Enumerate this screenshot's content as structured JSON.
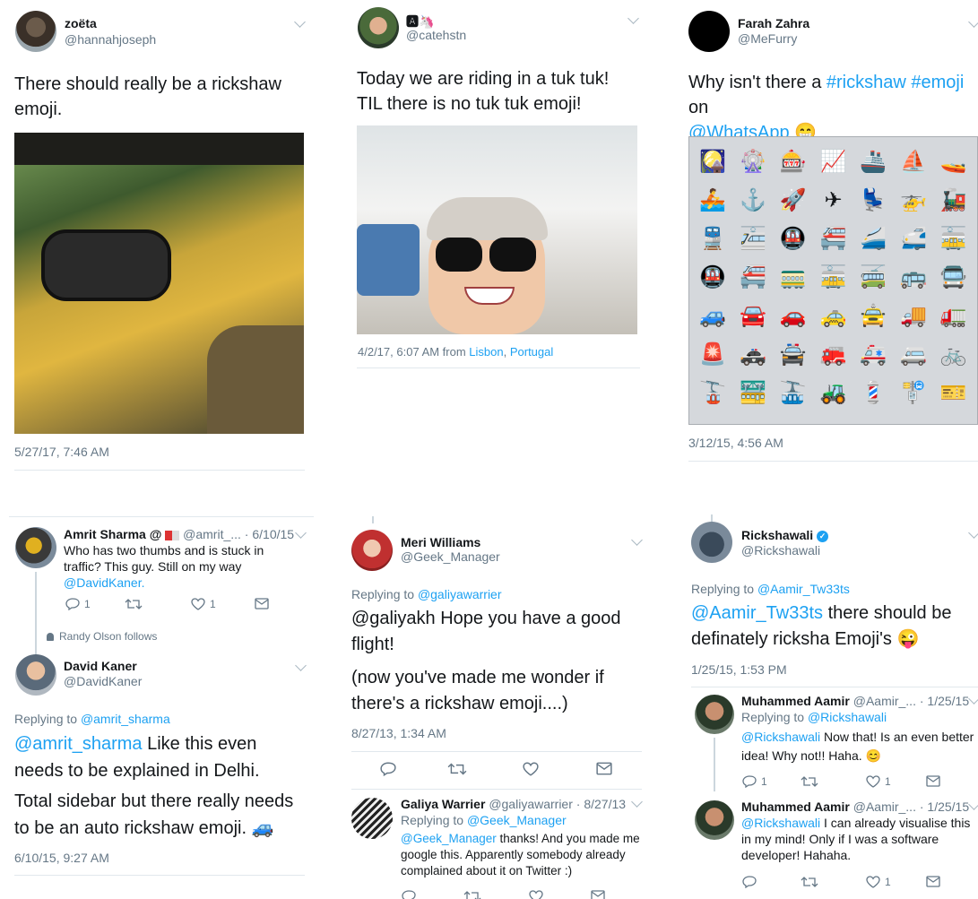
{
  "tweet1": {
    "name": "zoëta",
    "handle": "@hannahjoseph",
    "text": "There should really be a rickshaw emoji.",
    "timestamp": "5/27/17, 7:46 AM",
    "avatar_icon": "user-photo-icon"
  },
  "tweet2": {
    "name": "🅰🦄",
    "handle": "@catehstn",
    "text": "Today we are riding in a tuk tuk! TIL there is no tuk tuk emoji!",
    "time": "4/2/17, 6:07 AM from ",
    "place_city": "Lisbon",
    "place_sep": ", ",
    "place_country": "Portugal"
  },
  "tweet3": {
    "name": "Farah Zahra",
    "handle": "@MeFurry",
    "text_pre": "Why isn't there a ",
    "tag1": "#rickshaw",
    "tag2": "#emoji",
    "text_mid": " on",
    "mention": "@WhatsApp",
    "emoji": "😁",
    "timestamp": "3/12/15, 4:56 AM",
    "emoji_grid": [
      "🎑",
      "🎡",
      "🎰",
      "📈",
      "🚢",
      "⛵",
      "🚤",
      "🚣",
      "⚓",
      "🚀",
      "✈",
      "💺",
      "🚁",
      "🚂",
      "🚆",
      "🚈",
      "🚇",
      "🚝",
      "🚄",
      "🚅",
      "🚋",
      "🚇",
      "🚝",
      "🚃",
      "🚋",
      "🚎",
      "🚌",
      "🚍",
      "🚙",
      "🚘",
      "🚗",
      "🚕",
      "🚖",
      "🚚",
      "🚛",
      "🚨",
      "🚓",
      "🚔",
      "🚒",
      "🚑",
      "🚐",
      "🚲",
      "🚡",
      "🚟",
      "🚠",
      "🚜",
      "💈",
      "🚏",
      "🎫"
    ]
  },
  "tweet4": {
    "name": "Amrit Sharma @ ",
    "name_rest": "@amrit_... · 6/10/15",
    "text": "Who has two thumbs and is stuck in traffic? This guy. Still on my way",
    "mention": "@DavidKaner.",
    "reply_count": "1",
    "retweet_count": "",
    "like_count": "1",
    "follow_note": "Randy Olson follows",
    "name2": "David Kaner",
    "handle2": "@DavidKaner",
    "replying_label": "Replying to ",
    "replying_to": "@amrit_sharma",
    "mention2": "@amrit_sharma",
    "text2": " Like this even needs to be explained in Delhi.",
    "text3": "Total sidebar but there really needs to be an auto rickshaw emoji. 🚙",
    "timestamp": "6/10/15, 9:27 AM"
  },
  "tweet5": {
    "name": "Meri Williams",
    "handle": "@Geek_Manager",
    "replying_label": "Replying to ",
    "replying_to": "@galiyawarrier",
    "text": "@galiyakh Hope you have a good flight!",
    "text2": "(now you've made me wonder if there's a rickshaw emoji....)",
    "timestamp": "8/27/13, 1:34 AM",
    "reply_name": "Galiya Warrier",
    "reply_meta": "@galiyawarrier · 8/27/13",
    "reply_replying_label": "Replying to ",
    "reply_replying_to": "@Geek_Manager",
    "reply_mention": "@Geek_Manager",
    "reply_text": " thanks! And you made me google this. Apparently somebody already complained about it on Twitter :)"
  },
  "tweet6": {
    "name": "Rickshawali",
    "handle": "@Rickshawali",
    "replying_label": "Replying to ",
    "replying_to": "@Aamir_Tw33ts",
    "mention": "@Aamir_Tw33ts",
    "text": " there should be definately ricksha Emoji's 😜",
    "timestamp": "1/25/15, 1:53 PM",
    "r1_name": "Muhammed Aamir",
    "r1_meta": "@Aamir_... · 1/25/15",
    "r1_replying_label": "Replying to ",
    "r1_replying_to": "@Rickshawali",
    "r1_mention": "@Rickshawali",
    "r1_text": " Now that! Is an even better idea! Why not!! Haha. 😊",
    "r1_reply": "1",
    "r1_like": "1",
    "r2_name": "Muhammed Aamir",
    "r2_meta": "@Aamir_... · 1/25/15",
    "r2_mention": "@Rickshawali",
    "r2_text": " I can already visualise this in my mind! Only if I was a software developer! Hahaha.",
    "r2_like": "1"
  }
}
